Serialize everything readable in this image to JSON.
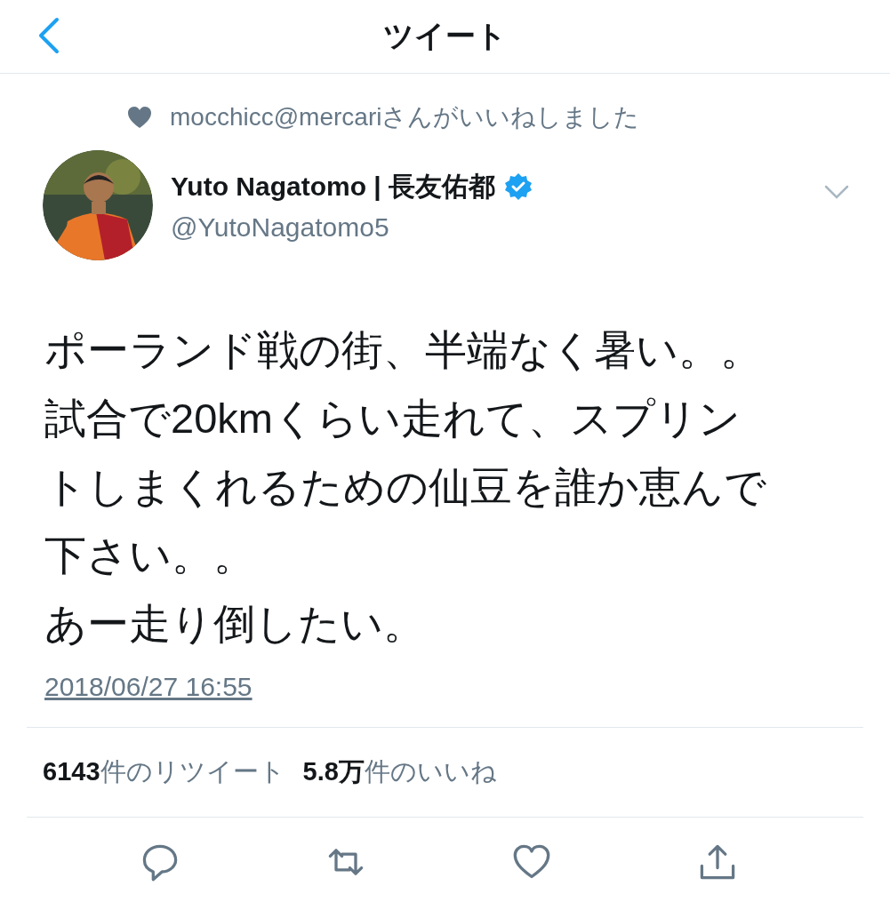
{
  "header": {
    "title": "ツイート"
  },
  "liked_by": {
    "text": "mocchicc@mercariさんがいいねしました"
  },
  "author": {
    "name": "Yuto Nagatomo | 長友佑都",
    "verified": true,
    "handle": "@YutoNagatomo5"
  },
  "tweet": {
    "lines": [
      "ポーランド戦の街、半端なく暑い。。",
      "試合で20kmくらい走れて、スプリン",
      "トしまくれるための仙豆を誰か恵んで",
      "下さい。。",
      "あー走り倒したい。"
    ],
    "timestamp": "2018/06/27 16:55"
  },
  "stats": [
    {
      "text": "**6143**件のリツイート"
    },
    {
      "text": "**5.8万**件のいいね"
    }
  ],
  "actions": [
    {
      "kind": "reply"
    },
    {
      "kind": "retweet"
    },
    {
      "kind": "like"
    },
    {
      "kind": "share"
    }
  ]
}
